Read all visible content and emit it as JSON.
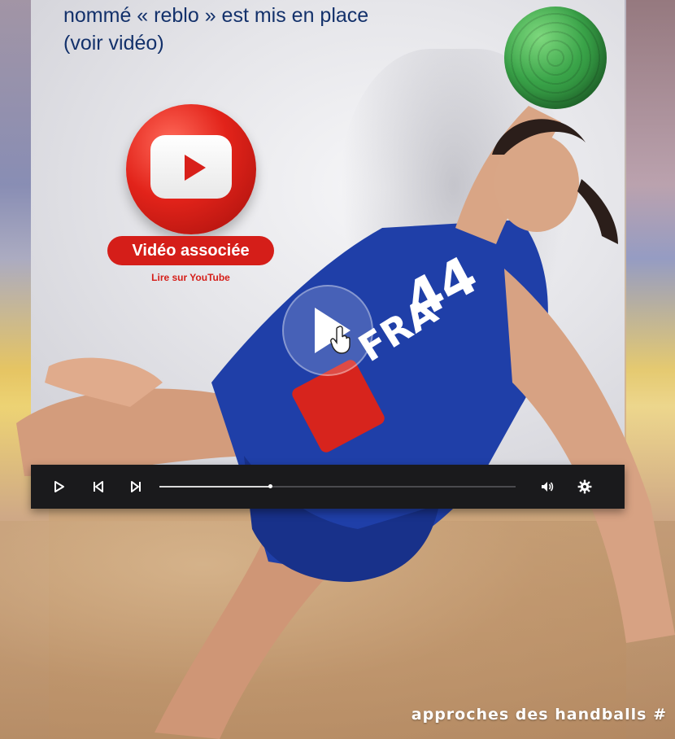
{
  "heading_lines": [
    "nommé « reblo » est mis en place",
    "(voir vidéo)"
  ],
  "youtube": {
    "badge_label": "Vidéo associée",
    "link_label": "Lire sur YouTube"
  },
  "player": {
    "jersey_text": "FRA",
    "jersey_number": "44",
    "progress_fraction": 0.31
  },
  "controls": {
    "play_icon": "play-icon",
    "prev_icon": "skip-back-icon",
    "next_icon": "skip-forward-icon",
    "volume_icon": "volume-icon",
    "settings_icon": "gear-icon"
  },
  "footer": {
    "text": "approches des handballs #"
  },
  "colors": {
    "youtube_red": "#d51e19",
    "heading_blue": "#13316b",
    "ball_green": "#3aa449",
    "jersey_blue": "#1f3fa8"
  }
}
